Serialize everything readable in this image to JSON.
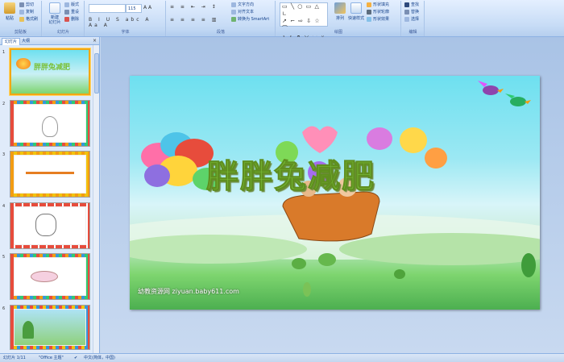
{
  "ribbon": {
    "clipboard": {
      "paste": "粘贴",
      "cut": "剪切",
      "copy": "复制",
      "format_painter": "格式刷",
      "label": "剪贴板"
    },
    "slides": {
      "new_slide": "新建\n幻灯片",
      "layout": "版式",
      "reset": "重设",
      "delete": "删除",
      "label": "幻灯片"
    },
    "font": {
      "font_name": "",
      "font_size": "115",
      "label": "字体"
    },
    "paragraph": {
      "text_direction": "文字方向",
      "align_text": "对齐文本",
      "smartart": "转换为 SmartArt",
      "label": "段落"
    },
    "drawing": {
      "arrange": "排列",
      "quick_styles": "快速样式",
      "shape_fill": "形状填充",
      "shape_outline": "形状轮廓",
      "shape_effects": "形状效果",
      "label": "绘图"
    },
    "editing": {
      "find": "查找",
      "replace": "替换",
      "select": "选择",
      "label": "编辑"
    }
  },
  "panel": {
    "tab_slides": "幻灯片",
    "tab_outline": "大纲",
    "close": "×",
    "thumbs": [
      {
        "num": "1",
        "caption": ""
      },
      {
        "num": "2",
        "caption": ""
      },
      {
        "num": "3",
        "caption": ""
      },
      {
        "num": "4",
        "caption": ""
      },
      {
        "num": "5",
        "caption": ""
      },
      {
        "num": "6",
        "caption": ""
      }
    ]
  },
  "slide": {
    "title": "胖胖兔减肥",
    "watermark": "幼教资源网 ziyuan.baby611.com",
    "watermark_small": ""
  },
  "status": {
    "slide_info": "幻灯片 1/11",
    "theme": "\"Office 主题\"",
    "language": "中文(简体，中国)"
  },
  "colors": {
    "accent": "#7cc13b",
    "selected_border": "#f3a712"
  }
}
